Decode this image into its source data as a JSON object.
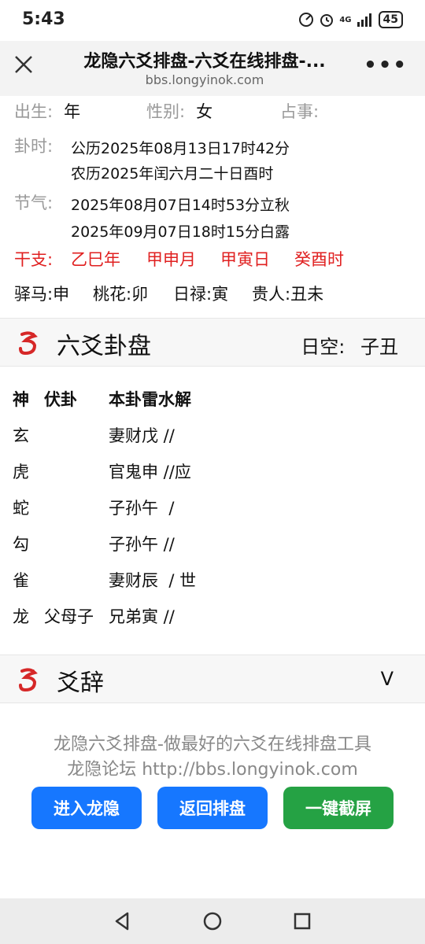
{
  "status": {
    "time": "5:43",
    "battery": "45",
    "network": "4G"
  },
  "browser": {
    "title": "龙隐六爻排盘-六爻在线排盘-...",
    "url": "bbs.longyinok.com"
  },
  "info": {
    "birth_label": "出生:",
    "birth_value": "年",
    "gender_label": "性别:",
    "gender_value": "女",
    "matter_label": "占事:",
    "gua_time_label": "卦时:",
    "gua_time_solar": "公历2025年08月13日17时42分",
    "gua_time_lunar": "农历2025年闰六月二十日酉时",
    "solar_term_label": "节气:",
    "solar_term_1": "2025年08月07日14时53分立秋",
    "solar_term_2": "2025年09月07日18时15分白露",
    "ganzhi_label": "干支:",
    "ganzhi": [
      "乙巳年",
      "甲申月",
      "甲寅日",
      "癸酉时"
    ],
    "shensha": [
      "驿马:申",
      "桃花:卯",
      "日禄:寅",
      "贵人:丑未"
    ]
  },
  "section1": {
    "title": "六爻卦盘",
    "kong_label": "日空:",
    "kong_value": "子丑"
  },
  "gua_table": {
    "headers": [
      "神",
      "伏卦",
      "本卦雷水解"
    ],
    "rows": [
      {
        "shen": "玄",
        "fu": "",
        "ben": "妻财戊 //"
      },
      {
        "shen": "虎",
        "fu": "",
        "ben": "官鬼申 //应"
      },
      {
        "shen": "蛇",
        "fu": "",
        "ben": "子孙午  /"
      },
      {
        "shen": "勾",
        "fu": "",
        "ben": "子孙午 //"
      },
      {
        "shen": "雀",
        "fu": "",
        "ben": "妻财辰  / 世"
      },
      {
        "shen": "龙",
        "fu": "父母子",
        "ben": "兄弟寅 //"
      }
    ]
  },
  "section2": {
    "title": "爻辞",
    "toggle": "V"
  },
  "footer": {
    "line1": "龙隐六爻排盘-做最好的六爻在线排盘工具",
    "line2": "龙隐论坛 http://bbs.longyinok.com",
    "btn_enter": "进入龙隐",
    "btn_back": "返回排盘",
    "btn_screenshot": "一键截屏"
  },
  "colors": {
    "red": "#e02020",
    "blue": "#1677ff",
    "green": "#25a244"
  }
}
